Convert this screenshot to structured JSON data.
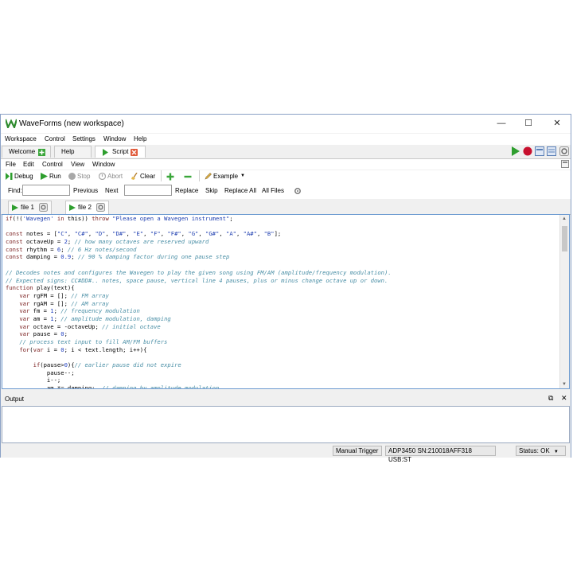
{
  "window": {
    "title": "WaveForms (new workspace)",
    "controls": {
      "minimize": "—",
      "maximize": "☐",
      "close": "✕"
    }
  },
  "menubar": [
    "Workspace",
    "Control",
    "Settings",
    "Window",
    "Help"
  ],
  "tabs": [
    {
      "label": "Welcome",
      "icon": "plus-icon"
    },
    {
      "label": "Help"
    },
    {
      "label": "Script",
      "icon": "close-tab-icon",
      "active": true
    }
  ],
  "script_menu": [
    "File",
    "Edit",
    "Control",
    "View",
    "Window"
  ],
  "toolbar": {
    "debug": "Debug",
    "run": "Run",
    "stop": "Stop",
    "abort": "Abort",
    "clear": "Clear",
    "example": "Example"
  },
  "findbar": {
    "find_label": "Find:",
    "find_value": "",
    "previous": "Previous",
    "next": "Next",
    "replace_value": "",
    "replace": "Replace",
    "skip": "Skip",
    "replace_all": "Replace All",
    "all_files": "All Files"
  },
  "file_tabs": [
    "file 1",
    "file 2"
  ],
  "code_lines": [
    "if(!('Wavegen' in this)) throw \"Please open a Wavegen instrument\";",
    "",
    "const notes = [\"C\", \"C#\", \"D\", \"D#\", \"E\", \"F\", \"F#\", \"G\", \"G#\", \"A\", \"A#\", \"B\"];",
    "const octaveUp = 2; // how many octaves are reserved upward",
    "const rhythm = 6; // 6 Hz notes/second",
    "const damping = 0.9; // 90 % damping factor during one pause step",
    "",
    "// Decodes notes and configures the Wavegen to play the given song using FM/AM (amplitude/frequency modulation).",
    "// Expected signs: CC#DD#.. notes, space pause, vertical line 4 pauses, plus or minus change octave up or down.",
    "function play(text){",
    "    var rgFM = []; // FM array",
    "    var rgAM = []; // AM array",
    "    var fm = 1; // frequency modulation",
    "    var am = 1; // amplitude modulation, damping",
    "    var octave = -octaveUp; // initial octave",
    "    var pause = 0;",
    "    // process text input to fill AM/FM buffers",
    "    for(var i = 0; i < text.length; i++){",
    "",
    "        if(pause>0){// earlier pause did not expire",
    "            pause--;",
    "            i--;",
    "            am *= damping;  // damping by amplitude modulation"
  ],
  "output": {
    "title": "Output",
    "text": ""
  },
  "statusbar": {
    "manual_trigger": "Manual Trigger",
    "device": "ADP3450 SN:210018AFF318 USB:ST",
    "status": "Status: OK"
  },
  "colors": {
    "accent_green": "#2e9e2e",
    "record_red": "#c8102e",
    "editor_border": "#6d9bd1"
  }
}
